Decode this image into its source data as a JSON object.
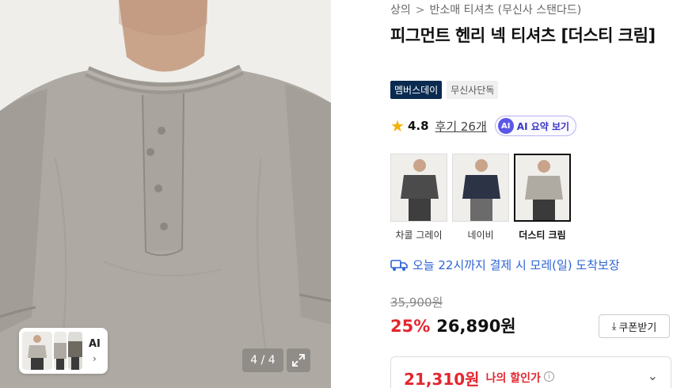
{
  "gallery": {
    "page_counter": "4 / 4",
    "ai_chip_label": "AI",
    "ai_chip_chevron": "›",
    "expand_icon": "expand-icon",
    "shirt_color": "#aeaaa3"
  },
  "breadcrumb": {
    "category": "상의",
    "separator": ">",
    "subcategory": "반소매 티셔츠 (무신사 스탠다드)"
  },
  "product": {
    "title": "피그먼트 헨리 넥 티셔츠 [더스티 크림]",
    "badges": [
      "멤버스데이",
      "무신사단독"
    ]
  },
  "rating": {
    "star_icon": "★",
    "score": "4.8",
    "reviews": "후기 26개",
    "ai_summary_badge": "AI",
    "ai_summary_label": "AI 요약 보기"
  },
  "colors": [
    {
      "name": "차콜 그레이",
      "hex": "#4a4b4a",
      "selected": false
    },
    {
      "name": "네이비",
      "hex": "#2b3345",
      "selected": false
    },
    {
      "name": "더스티 크림",
      "hex": "#b0aba2",
      "selected": true
    }
  ],
  "delivery": {
    "text": "오늘 22시까지 결제 시 모레(일) 도착보장",
    "color": "#2e64d6"
  },
  "pricing": {
    "original": "35,900원",
    "discount": "25%",
    "sale": "26,890원",
    "coupon_icon": "⤓",
    "coupon_label": "쿠폰받기",
    "my_price": "21,310원",
    "my_price_label": "나의 할인가",
    "info_icon": "i",
    "chevron": "⌄",
    "accent_red": "#e3262f"
  }
}
